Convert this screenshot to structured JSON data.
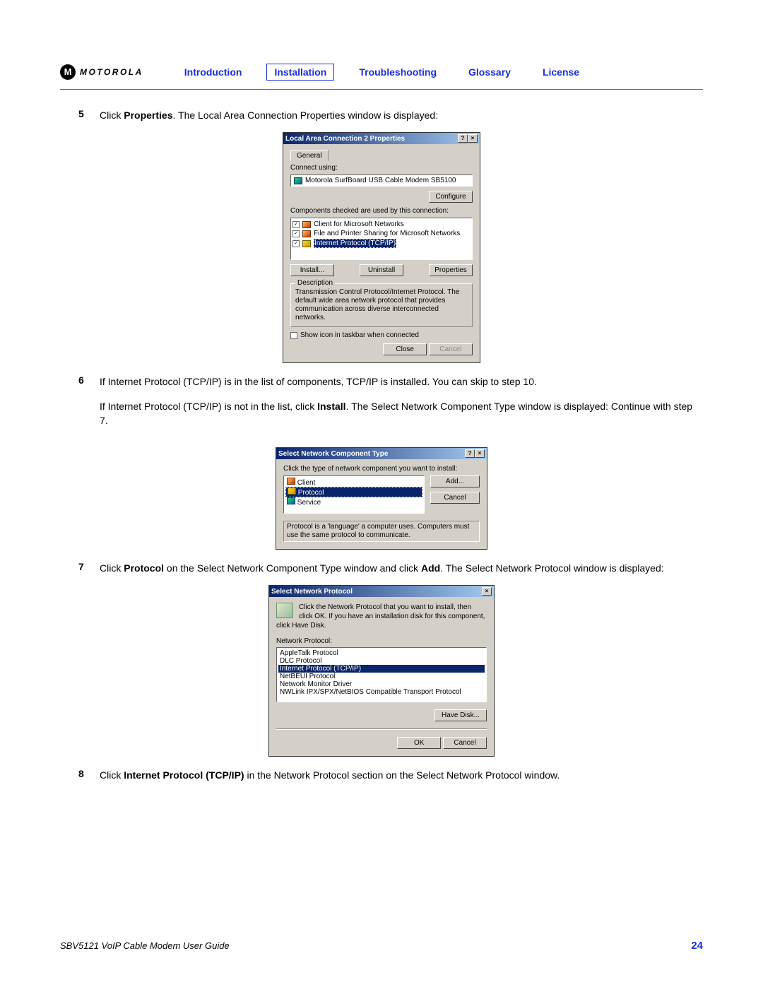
{
  "header": {
    "brand": "MOTOROLA",
    "tabs": [
      "Introduction",
      "Installation",
      "Troubleshooting",
      "Glossary",
      "License"
    ],
    "active_tab_index": 1
  },
  "steps": {
    "s5": {
      "num": "5",
      "text_prefix": "Click ",
      "bold1": "Properties",
      "text_suffix": ". The Local Area Connection Properties window is displayed:"
    },
    "s6": {
      "num": "6",
      "para1": "If Internet Protocol (TCP/IP) is in the list of components, TCP/IP is installed. You can skip to step 10.",
      "para2_prefix": "If Internet Protocol (TCP/IP) is not in the list, click ",
      "para2_bold": "Install",
      "para2_suffix": ". The Select Network Component Type window is displayed: Continue with step 7."
    },
    "s7": {
      "num": "7",
      "t1": "Click ",
      "b1": "Protocol",
      "t2": " on the Select Network Component Type window and click ",
      "b2": "Add",
      "t3": ". The Select Network Protocol window is displayed:"
    },
    "s8": {
      "num": "8",
      "t1": "Click ",
      "b1": "Internet Protocol (TCP/IP)",
      "t2": " in the Network Protocol section on the Select Network Protocol window."
    }
  },
  "dialog1": {
    "title": "Local Area Connection 2 Properties",
    "tab": "General",
    "connect_using_label": "Connect using:",
    "device": "Motorola SurfBoard USB Cable Modem SB5100",
    "configure_btn": "Configure",
    "components_label": "Components checked are used by this connection:",
    "components": [
      "Client for Microsoft Networks",
      "File and Printer Sharing for Microsoft Networks",
      "Internet Protocol (TCP/IP)"
    ],
    "install_btn": "Install...",
    "uninstall_btn": "Uninstall",
    "properties_btn": "Properties",
    "desc_label": "Description",
    "desc_text": "Transmission Control Protocol/Internet Protocol. The default wide area network protocol that provides communication across diverse interconnected networks.",
    "show_icon": "Show icon in taskbar when connected",
    "close_btn": "Close",
    "cancel_btn": "Cancel"
  },
  "dialog2": {
    "title": "Select Network Component Type",
    "instruct": "Click the type of network component you want to install:",
    "items": [
      "Client",
      "Protocol",
      "Service"
    ],
    "add_btn": "Add...",
    "cancel_btn": "Cancel",
    "hint": "Protocol is a 'language' a computer uses. Computers must use the same protocol to communicate."
  },
  "dialog3": {
    "title": "Select Network Protocol",
    "instruct": "Click the Network Protocol that you want to install, then click OK. If you have an installation disk for this component, click Have Disk.",
    "list_label": "Network Protocol:",
    "protocols": [
      "AppleTalk Protocol",
      "DLC Protocol",
      "Internet Protocol (TCP/IP)",
      "NetBEUI Protocol",
      "Network Monitor Driver",
      "NWLink IPX/SPX/NetBIOS Compatible Transport Protocol"
    ],
    "have_disk_btn": "Have Disk...",
    "ok_btn": "OK",
    "cancel_btn": "Cancel"
  },
  "footer": {
    "doc": "SBV5121 VoIP Cable Modem User Guide",
    "page": "24"
  }
}
